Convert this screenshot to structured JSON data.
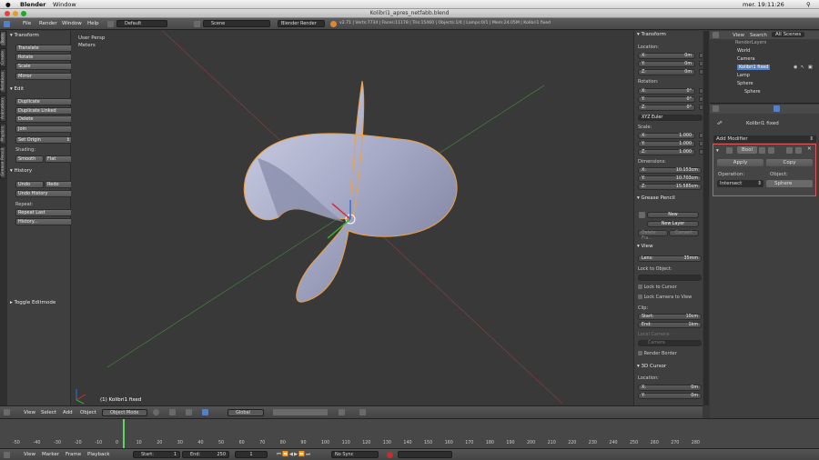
{
  "mac": {
    "app": "Blender",
    "menu_window": "Window",
    "clock": "mer. 19:11:26"
  },
  "window_title": "Kolibri1_apres_netfabb.blend",
  "info": {
    "menus": [
      "File",
      "Render",
      "Window",
      "Help"
    ],
    "screen": "Default",
    "scene": "Scene",
    "engine": "Blender Render",
    "stats": "v2.71 | Verts:7734 | Faces:11178 | Tris:15460 | Objects:1/4 | Lamps:0/1 | Mem:24.05M | Kolibri1 fixed"
  },
  "tool_tabs": [
    "Tools",
    "Create",
    "Relations",
    "Animation",
    "Physics",
    "Grease Pencil"
  ],
  "shelf": {
    "transform": {
      "title": "Transform",
      "buttons": [
        "Translate",
        "Rotate",
        "Scale",
        "Mirror"
      ]
    },
    "edit": {
      "title": "Edit",
      "buttons": [
        "Duplicate",
        "Duplicate Linked",
        "Delete",
        "Join"
      ],
      "set_origin": "Set Origin",
      "shading_label": "Shading:",
      "smooth": "Smooth",
      "flat": "Flat"
    },
    "history": {
      "title": "History",
      "undo": "Undo",
      "redo": "Redo",
      "undo_history": "Undo History",
      "repeat_label": "Repeat:",
      "repeat_last": "Repeat Last",
      "history": "History..."
    },
    "toggle": "Toggle Editmode"
  },
  "viewport": {
    "view_name": "User Persp",
    "units": "Meters",
    "object_label": "(1) Kolibri1 fixed"
  },
  "npanel": {
    "transform_title": "Transform",
    "location_label": "Location:",
    "location": [
      {
        "k": "X:",
        "v": "0m"
      },
      {
        "k": "Y:",
        "v": "0m"
      },
      {
        "k": "Z:",
        "v": "0m"
      }
    ],
    "rotation_label": "Rotation:",
    "rotation": [
      {
        "k": "X:",
        "v": "0°"
      },
      {
        "k": "Y:",
        "v": "0°"
      },
      {
        "k": "Z:",
        "v": "0°"
      }
    ],
    "rot_mode": "XYZ Euler",
    "scale_label": "Scale:",
    "scale": [
      {
        "k": "X:",
        "v": "1.000"
      },
      {
        "k": "Y:",
        "v": "1.000"
      },
      {
        "k": "Z:",
        "v": "1.000"
      }
    ],
    "dimensions_label": "Dimensions:",
    "dimensions": [
      {
        "k": "X:",
        "v": "10.153cm"
      },
      {
        "k": "Y:",
        "v": "10.703cm"
      },
      {
        "k": "Z:",
        "v": "15.585cm"
      }
    ],
    "grease_title": "Grease Pencil",
    "new": "New",
    "new_layer": "New Layer",
    "delete_fra": "Delete Fra...",
    "convert": "Convert",
    "view_title": "View",
    "lens": {
      "k": "Lens:",
      "v": "35mm"
    },
    "lock_object": "Lock to Object:",
    "lock_cursor": "Lock to Cursor",
    "lock_camera": "Lock Camera to View",
    "clip_label": "Clip:",
    "clip_start": {
      "k": "Start:",
      "v": "10cm"
    },
    "clip_end": {
      "k": "End:",
      "v": "1km"
    },
    "local_camera": "Local Camera:",
    "local_camera_value": "Camera",
    "render_border": "Render Border",
    "cursor_title": "3D Cursor",
    "cursor_location": "Location:",
    "cursor": [
      {
        "k": "X:",
        "v": "0m"
      },
      {
        "k": "Y:",
        "v": "0m"
      },
      {
        "k": "Z:",
        "v": "0m"
      }
    ]
  },
  "outliner": {
    "view": "View",
    "search": "Search",
    "scope": "All Scenes",
    "items": [
      "RenderLayers",
      "World",
      "Camera",
      "Kolibri1 fixed",
      "Lamp",
      "Sphere",
      "Sphere"
    ]
  },
  "properties": {
    "object_name": "Kolibri1 fixed",
    "add_modifier": "Add Modifier",
    "modifier_name": "Bool",
    "apply": "Apply",
    "copy": "Copy",
    "operation_label": "Operation:",
    "operation": "Intersect",
    "object_label": "Object:",
    "object": "Sphere"
  },
  "vp_header": {
    "menus": [
      "View",
      "Select",
      "Add",
      "Object"
    ],
    "mode": "Object Mode",
    "orientation": "Global"
  },
  "timeline": {
    "ticks": [
      "-50",
      "-40",
      "-30",
      "-20",
      "-10",
      "0",
      "10",
      "20",
      "30",
      "40",
      "50",
      "60",
      "70",
      "80",
      "90",
      "100",
      "110",
      "120",
      "130",
      "140",
      "150",
      "160",
      "170",
      "180",
      "190",
      "200",
      "210",
      "220",
      "230",
      "240",
      "250",
      "260",
      "270",
      "280"
    ]
  },
  "tl_header": {
    "menus": [
      "View",
      "Marker",
      "Frame",
      "Playback"
    ],
    "start": {
      "k": "Start:",
      "v": "1"
    },
    "end": {
      "k": "End:",
      "v": "250"
    },
    "current": "1",
    "sync": "No Sync"
  },
  "colors": {
    "accent": "#5680c2",
    "highlight": "#e05555",
    "select_outline": "#f0a040"
  }
}
